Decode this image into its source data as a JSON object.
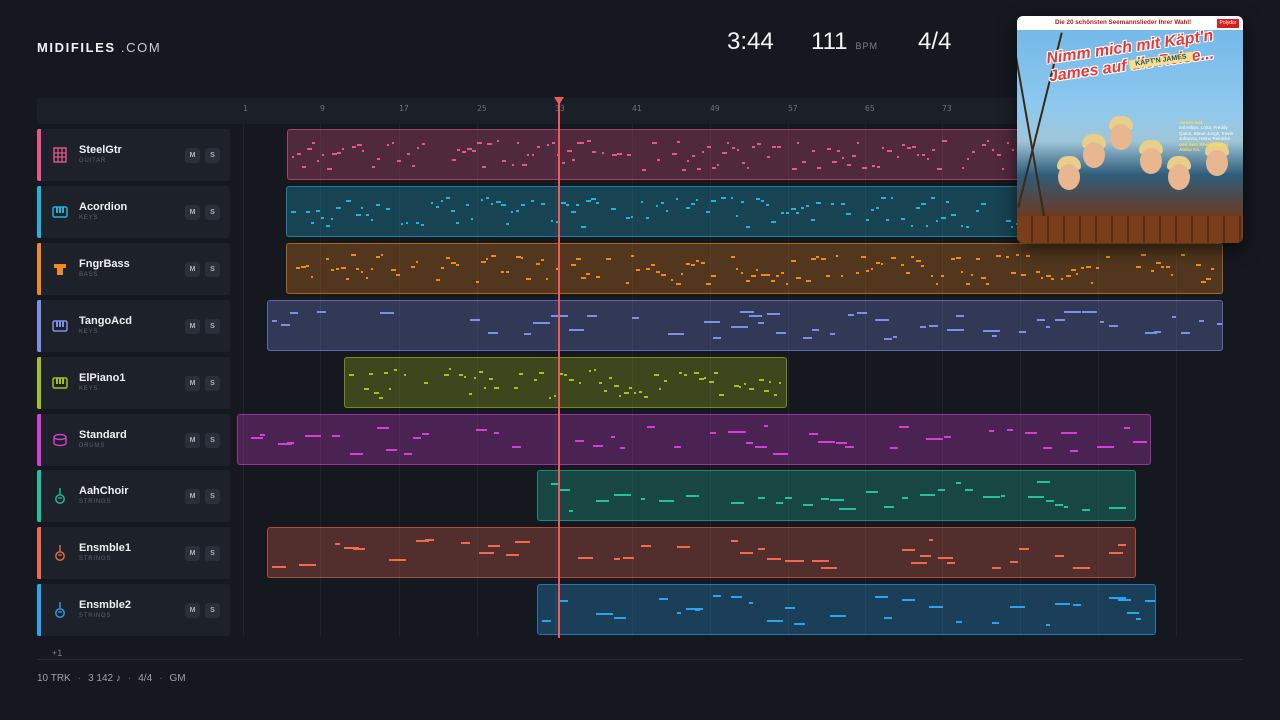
{
  "brand": {
    "name": "MIDIFILES",
    "suffix": ".COM"
  },
  "stats": {
    "duration": "3:44",
    "tempo": "111",
    "tempo_unit": "BPM",
    "time_signature": "4/4"
  },
  "cover": {
    "top_line": "Die 20 schönsten Seemannslieder Ihrer Wahl!",
    "label": "Polydor",
    "title": "Nimm mich mit Käpt'n James auf die Reise...",
    "tag": "KÄPT'N JAMES",
    "credits_lead": "James last",
    "credits": "mit Hilton, Lotta, Freddy Quinn, Blaue Jungs, Kevin Johanna, Heino Reinicke",
    "credits_tail": "und dem Rheinhardtig Aloha Co."
  },
  "ruler": {
    "ticks": [
      "1",
      "9",
      "17",
      "25",
      "33",
      "41",
      "49",
      "57",
      "65",
      "73"
    ]
  },
  "tracks": [
    {
      "name": "SteelGtr",
      "category": "GUITAR",
      "color": "#e8578a",
      "icon": "guitar-icon",
      "mute": "M",
      "solo": "S"
    },
    {
      "name": "Acordion",
      "category": "KEYS",
      "color": "#22b3d6",
      "icon": "keys-icon",
      "mute": "M",
      "solo": "S"
    },
    {
      "name": "FngrBass",
      "category": "BASS",
      "color": "#f08a1c",
      "icon": "bass-icon",
      "mute": "M",
      "solo": "S"
    },
    {
      "name": "TangoAcd",
      "category": "KEYS",
      "color": "#7e8fea",
      "icon": "keys-icon",
      "mute": "M",
      "solo": "S"
    },
    {
      "name": "ElPiano1",
      "category": "KEYS",
      "color": "#a5c11e",
      "icon": "keys-icon",
      "mute": "M",
      "solo": "S"
    },
    {
      "name": "Standard",
      "category": "DRUMS",
      "color": "#d63fd6",
      "icon": "drum-icon",
      "mute": "M",
      "solo": "S"
    },
    {
      "name": "AahChoir",
      "category": "STRINGS",
      "color": "#21c2a0",
      "icon": "violin-icon",
      "mute": "M",
      "solo": "S"
    },
    {
      "name": "Ensmble1",
      "category": "STRINGS",
      "color": "#f26a4e",
      "icon": "violin-icon",
      "mute": "M",
      "solo": "S"
    },
    {
      "name": "Ensmble2",
      "category": "STRINGS",
      "color": "#2ba4ee",
      "icon": "violin-icon",
      "mute": "M",
      "solo": "S"
    }
  ],
  "more_tracks": "+1",
  "footer": {
    "tracks": "10 TRK",
    "notes": "3 142 ♪",
    "signature": "4/4",
    "standard": "GM"
  }
}
